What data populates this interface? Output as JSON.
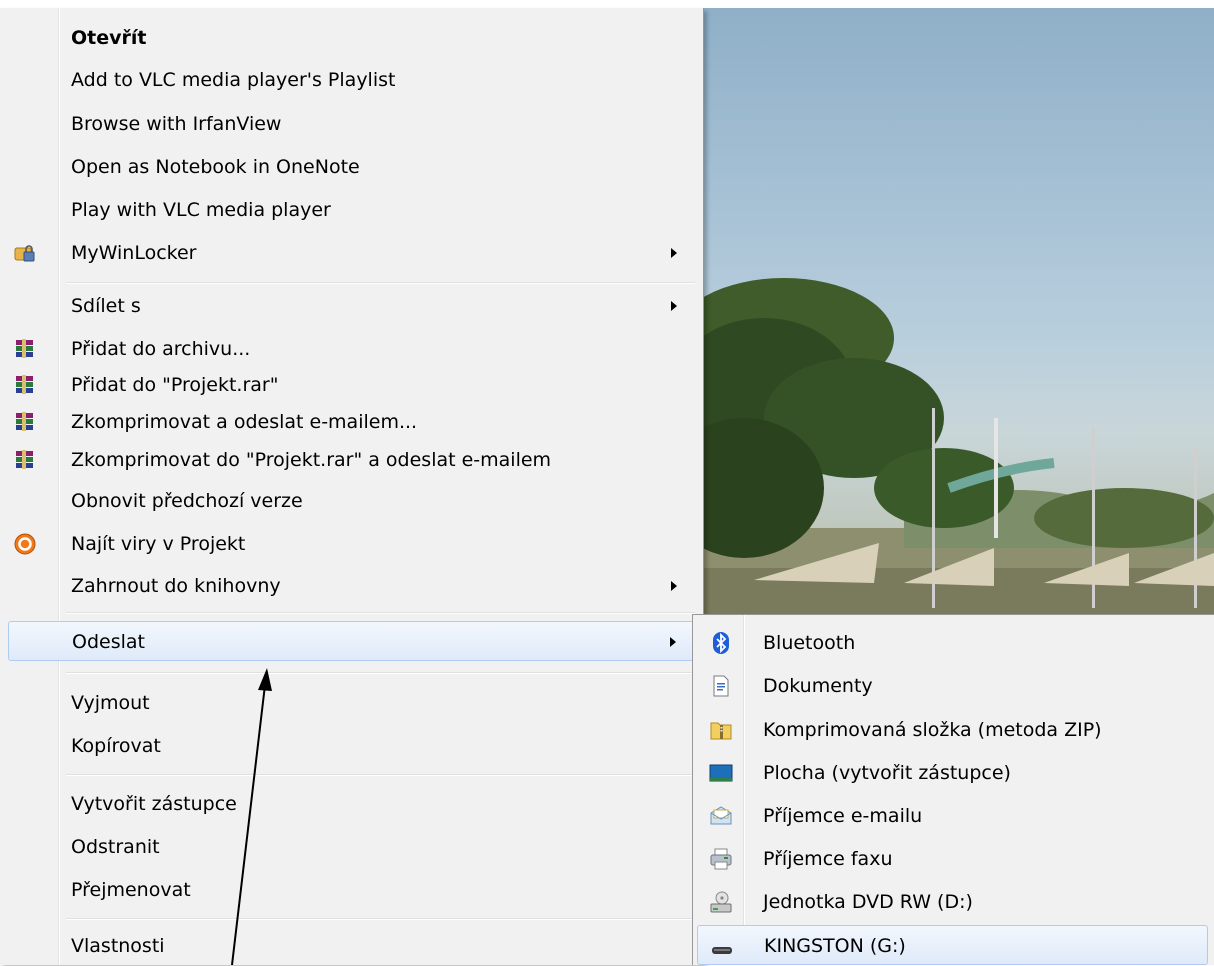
{
  "menu": {
    "items": [
      {
        "label": "Otevřít"
      },
      {
        "label": "Add to VLC media player's Playlist"
      },
      {
        "label": "Browse with IrfanView"
      },
      {
        "label": "Open as Notebook in OneNote"
      },
      {
        "label": "Play with VLC media player"
      },
      {
        "label": "MyWinLocker"
      },
      {
        "label": "Sdílet s"
      },
      {
        "label": "Přidat do archivu..."
      },
      {
        "label": "Přidat do \"Projekt.rar\""
      },
      {
        "label": "Zkomprimovat a odeslat e-mailem..."
      },
      {
        "label": "Zkomprimovat do \"Projekt.rar\" a odeslat e-mailem"
      },
      {
        "label": "Obnovit předchozí verze"
      },
      {
        "label": "Najít viry v Projekt"
      },
      {
        "label": "Zahrnout do knihovny"
      },
      {
        "label": "Odeslat"
      },
      {
        "label": "Vyjmout"
      },
      {
        "label": "Kopírovat"
      },
      {
        "label": "Vytvořit zástupce"
      },
      {
        "label": "Odstranit"
      },
      {
        "label": "Přejmenovat"
      },
      {
        "label": "Vlastnosti"
      }
    ]
  },
  "submenu": {
    "items": [
      {
        "label": "Bluetooth"
      },
      {
        "label": "Dokumenty"
      },
      {
        "label": "Komprimovaná složka (metoda ZIP)"
      },
      {
        "label": "Plocha (vytvořit zástupce)"
      },
      {
        "label": "Příjemce e-mailu"
      },
      {
        "label": "Příjemce faxu"
      },
      {
        "label": "Jednotka DVD RW (D:)"
      },
      {
        "label": "KINGSTON (G:)"
      }
    ]
  },
  "colors": {
    "menu_bg": "#f1f1f1",
    "hover_border": "#aecbf1",
    "hover_bg": "#dfeaf9"
  }
}
